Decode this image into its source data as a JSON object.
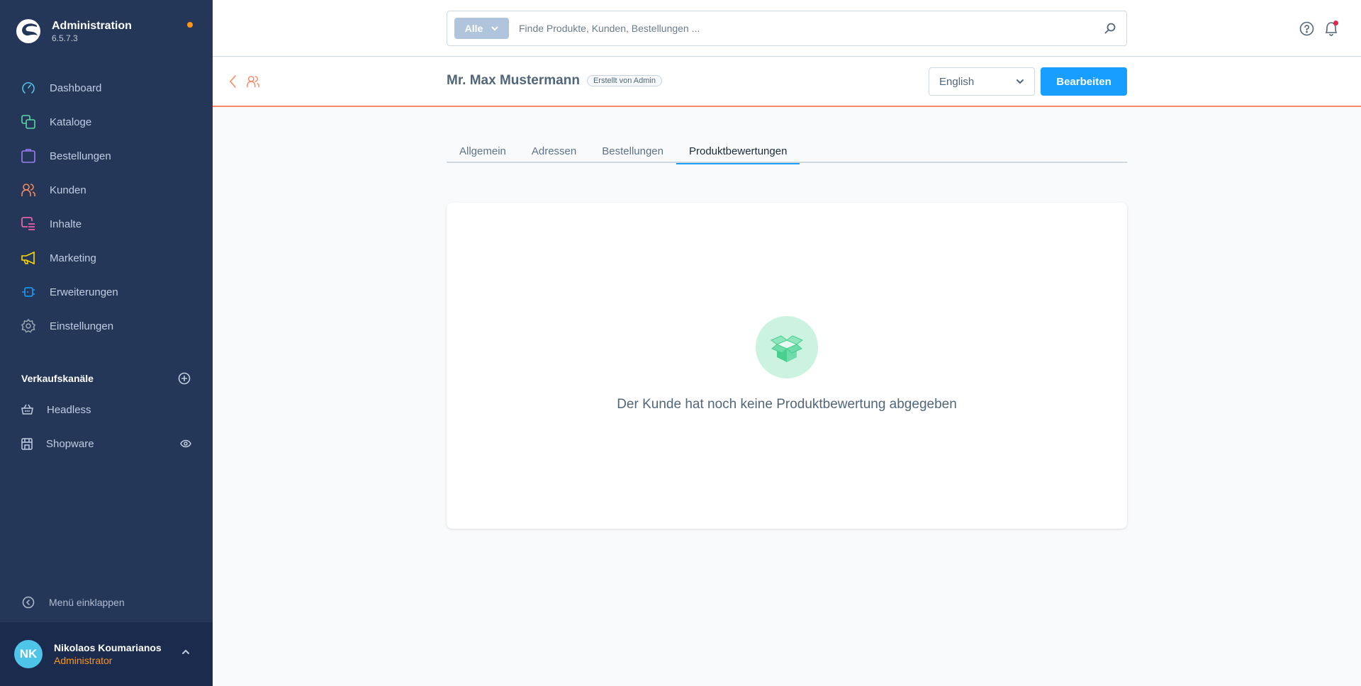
{
  "brand": {
    "title": "Administration",
    "version": "6.5.7.3",
    "status_dot_color": "#ff9516"
  },
  "sidebar": {
    "items": [
      {
        "label": "Dashboard",
        "icon": "dashboard-icon",
        "color": "#4ec4e8"
      },
      {
        "label": "Kataloge",
        "icon": "catalog-icon",
        "color": "#57d9a3"
      },
      {
        "label": "Bestellungen",
        "icon": "orders-icon",
        "color": "#9a7ff5"
      },
      {
        "label": "Kunden",
        "icon": "customers-icon",
        "color": "#f88962"
      },
      {
        "label": "Inhalte",
        "icon": "content-icon",
        "color": "#ff68b4"
      },
      {
        "label": "Marketing",
        "icon": "marketing-icon",
        "color": "#ffd700"
      },
      {
        "label": "Erweiterungen",
        "icon": "extensions-icon",
        "color": "#189eff"
      },
      {
        "label": "Einstellungen",
        "icon": "settings-icon",
        "color": "#9aa8b5"
      }
    ],
    "sales_channels": {
      "title": "Verkaufskanäle",
      "items": [
        {
          "label": "Headless",
          "icon": "basket-icon"
        },
        {
          "label": "Shopware",
          "icon": "storefront-icon"
        }
      ]
    },
    "collapse_label": "Menü einklappen",
    "user": {
      "initials": "NK",
      "name": "Nikolaos Koumarianos",
      "role": "Administrator"
    }
  },
  "search": {
    "type_label": "Alle",
    "placeholder": "Finde Produkte, Kunden, Bestellungen ...",
    "value": ""
  },
  "smartbar": {
    "title": "Mr. Max Mustermann",
    "badge": "Erstellt von Admin",
    "language": "English",
    "edit_label": "Bearbeiten"
  },
  "tabs": [
    {
      "label": "Allgemein",
      "active": false
    },
    {
      "label": "Adressen",
      "active": false
    },
    {
      "label": "Bestellungen",
      "active": false
    },
    {
      "label": "Produktbewertungen",
      "active": true
    }
  ],
  "empty_state": {
    "icon": "open-box-icon",
    "message": "Der Kunde hat noch keine Produktbewertung abgegeben"
  },
  "colors": {
    "accent": "#189eff",
    "module": "#f88962",
    "sidebar_bg": "#243758"
  }
}
